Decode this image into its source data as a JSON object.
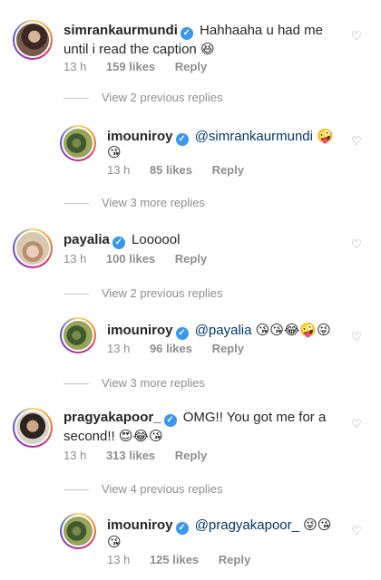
{
  "comments": [
    {
      "username": "simrankaurmundi",
      "text_line1": "Hahhaaha u had me",
      "text_line2": "until i read the caption",
      "emoji": "😆",
      "time": "13 h",
      "likes": "159 likes",
      "reply": "Reply"
    },
    {
      "username": "payalia",
      "text": "Loooool",
      "time": "13 h",
      "likes": "100 likes",
      "reply": "Reply"
    },
    {
      "username": "pragyakapoor_",
      "text_line1": "OMG!! You got me for a",
      "text_line2": "second!!",
      "emoji": "😍😂😘",
      "time": "13 h",
      "likes": "313 likes",
      "reply": "Reply"
    }
  ],
  "replies": [
    {
      "username": "imouniroy",
      "mention": "@simrankaurmundi",
      "emoji1": "🤪",
      "emoji2": "😘",
      "time": "13 h",
      "likes": "85 likes",
      "reply": "Reply"
    },
    {
      "username": "imouniroy",
      "mention": "@payalia",
      "emoji": "😘😘😂🤪😜",
      "time": "13 h",
      "likes": "96 likes",
      "reply": "Reply"
    },
    {
      "username": "imouniroy",
      "mention": "@pragyakapoor_",
      "emoji1": "😜😘",
      "emoji2": "😘",
      "time": "13 h",
      "likes": "125 likes",
      "reply": "Reply"
    }
  ],
  "threads": {
    "prev1": "View 2 previous replies",
    "more1": "View 3 more replies",
    "prev2": "View 2 previous replies",
    "more2": "View 3 more replies",
    "prev3": "View 4 previous replies"
  },
  "icons": {
    "heart": "heart-outline-icon",
    "verified": "verified-badge-icon"
  },
  "colors": {
    "verified": "#3897f0",
    "mention": "#00376b",
    "meta": "#8e8e8e"
  }
}
